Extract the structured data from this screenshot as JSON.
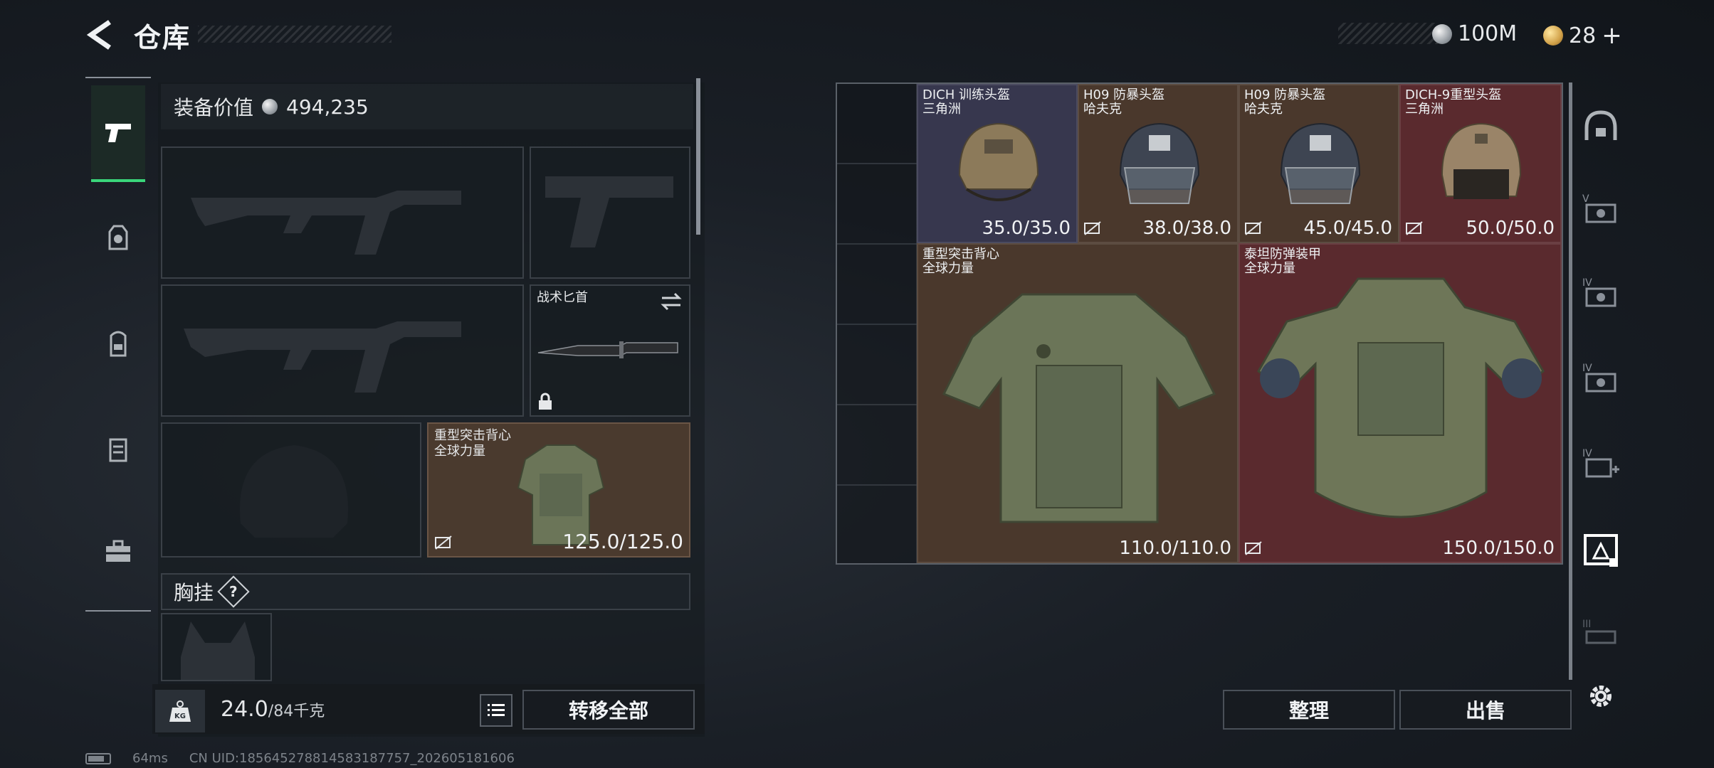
{
  "header": {
    "title": "仓库",
    "currencies": [
      {
        "icon": "silver-coin-icon",
        "value": "100M"
      },
      {
        "icon": "gold-coin-icon",
        "value": "28"
      }
    ],
    "add_label": "+"
  },
  "rail": {
    "items": [
      {
        "icon": "pistol-icon",
        "active": true
      },
      {
        "icon": "helmet-armor-icon"
      },
      {
        "icon": "backpack-icon"
      },
      {
        "icon": "chest-rig-icon"
      },
      {
        "icon": "toolbox-icon"
      }
    ]
  },
  "equipment": {
    "value_label": "装备价值",
    "value": "494,235",
    "knife_label": "战术匕首",
    "vest": {
      "name": "重型突击背心",
      "maker": "全球力量",
      "durability": "125.0/125.0"
    },
    "chest_rig_label": "胸挂",
    "help_label": "?"
  },
  "weight": {
    "current": "24.0",
    "max": "/84千克",
    "kg_label": "KG"
  },
  "buttons": {
    "transfer_all": "转移全部",
    "sort": "整理",
    "sell": "出售"
  },
  "stash": {
    "items": [
      {
        "name": "DICH 训练头盔",
        "maker": "三角洲",
        "durability": "35.0/35.0",
        "color": "#37374e",
        "insured": true
      },
      {
        "name": "H09 防暴头盔",
        "maker": "哈夫克",
        "durability": "38.0/38.0",
        "color": "#4a382c",
        "insured": false
      },
      {
        "name": "H09 防暴头盔",
        "maker": "哈夫克",
        "durability": "45.0/45.0",
        "color": "#4a382c",
        "insured": false
      },
      {
        "name": "DICH-9重型头盔",
        "maker": "三角洲",
        "durability": "50.0/50.0",
        "color": "#5a2a2e",
        "insured": false
      },
      {
        "name": "重型突击背心",
        "maker": "全球力量",
        "durability": "110.0/110.0",
        "color": "#4a382c",
        "insured": false
      },
      {
        "name": "泰坦防弹装甲",
        "maker": "全球力量",
        "durability": "150.0/150.0",
        "color": "#5a2a2e",
        "insured": false
      }
    ]
  },
  "filters": {
    "items": [
      {
        "icon": "helmet-filter-icon"
      },
      {
        "icon": "armor-v-filter-icon",
        "tier": "V"
      },
      {
        "icon": "armor-iv-filter-icon",
        "tier": "IV"
      },
      {
        "icon": "armor-iv-filter-icon-2",
        "tier": "IV"
      },
      {
        "icon": "armor-iv-medical-filter-icon",
        "tier": "IV"
      },
      {
        "icon": "armor-filter-active-icon"
      },
      {
        "icon": "armor-iii-filter-icon",
        "tier": "III"
      },
      {
        "icon": "settings-icon"
      }
    ]
  },
  "status": {
    "ping": "64ms",
    "uid": "CN UID:185645278814583187757_202605181606"
  },
  "colors": {
    "accent_green": "#3ad67a",
    "purple": "#37374e",
    "brown": "#4a382c",
    "red": "#5a2a2e"
  }
}
